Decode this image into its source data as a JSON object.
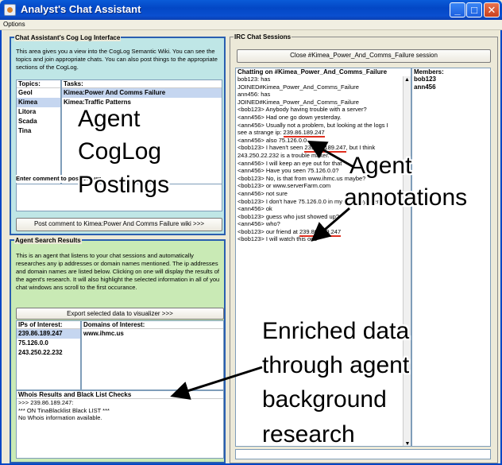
{
  "window": {
    "title": "Analyst's Chat Assistant"
  },
  "menu": {
    "options": "Options"
  },
  "coglog": {
    "title": "Chat Assistant's Cog Log Interface",
    "description": "This area gives you a view into the CogLog Semantic Wiki. You can see the topics and join appropriate chats. You can also post things to the appropriate sections of the CogLog.",
    "topics_header": "Topics:",
    "tasks_header": "Tasks:",
    "topics": [
      "Geol",
      "Kimea",
      "Litora",
      "Scada",
      "Tina"
    ],
    "tasks": [
      "Kimea:Power And Comms Failure",
      "Kimea:Traffic Patterns"
    ],
    "comment_label": "Enter comment to post below:",
    "post_button": "Post comment to Kimea:Power And Comms Failure wiki >>>"
  },
  "agent": {
    "title": "Agent Search Results",
    "description": "This is an agent that listens to your chat sessions and automatically researches any ip addresses or domain names mentioned. The ip addresses and domain names are listed below. Clicking on one will display the results of the agent's research. It will also highlight the selected information in all of you chat windows ans scroll to the first occurance.",
    "export_button": "Export selected data to visualizer >>>",
    "ips_header": "IPs of Interest:",
    "domains_header": "Domains of Interest:",
    "ips": [
      "239.86.189.247",
      "75.126.0.0",
      "243.250.22.232"
    ],
    "domains": [
      "www.ihmc.us"
    ],
    "whois_header": "Whois Results and Black List Checks",
    "whois_lines": [
      ">>> 239.86.189.247:",
      "*** ON TinaBlacklist Black LIST ***",
      " No Whois information available."
    ]
  },
  "irc": {
    "title": "IRC Chat Sessions",
    "close_button": "Close #Kimea_Power_And_Comms_Failure session",
    "chat_header": "Chatting on #Kimea_Power_And_Comms_Failure",
    "members_header": "Members:",
    "members": [
      "bob123",
      "ann456"
    ],
    "chat_lines": [
      "bob123: has",
      "JOINED#Kimea_Power_And_Comms_Failure",
      "ann456: has",
      "JOINED#Kimea_Power_And_Comms_Failure",
      "<bob123> Anybody having trouble with a server?",
      "<ann456> Had one go down yesterday.",
      "<ann456> Usually not a problem, but looking at the logs I",
      "see a strange ip: 239.86.189.247",
      "<ann456> also 75.126.0.0",
      "<bob123> I haven't seen 239.86.189.247, but I think",
      "243.250.22.232 is a trouble maker.",
      "<ann456> I will keep an eye out for that",
      "<ann456> Have you seen 75.126.0.0?",
      "<bob123> No, is that from www.ihmc.us maybe?",
      "<bob123> or www.serverFarm.com",
      "<ann456> not sure",
      "<bob123> I don't have 75.126.0.0 in my logs anywhere",
      "<ann456> ok",
      "<bob123> guess who just showed up?",
      "<ann456> who?",
      "<bob123> our friend at 239.86.189.247",
      "<bob123> I will watch this one"
    ]
  },
  "annotations": {
    "agent_cog_1": "Agent",
    "agent_cog_2": "CogLog",
    "agent_cog_3": "Postings",
    "agent_annot_1": "Agent",
    "agent_annot_2": "annotations",
    "enriched_1": "Enriched data",
    "enriched_2": "through agent",
    "enriched_3": "background",
    "enriched_4": "research"
  }
}
